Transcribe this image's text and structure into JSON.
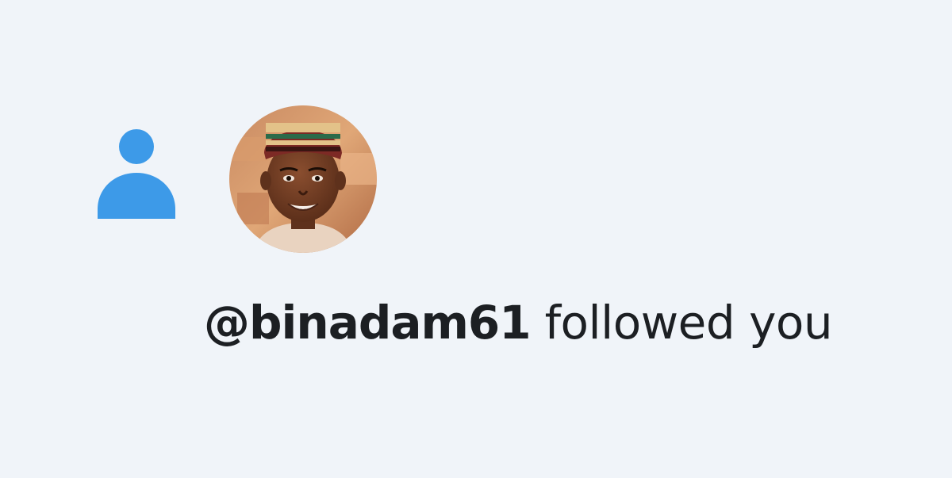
{
  "notification": {
    "type_icon": "person-icon",
    "avatar_icon": "user-avatar",
    "handle": "@binadam61",
    "action_text": "followed you",
    "colors": {
      "background": "#f0f4f9",
      "accent": "#3d9ae8",
      "text": "#1c1f23"
    }
  }
}
